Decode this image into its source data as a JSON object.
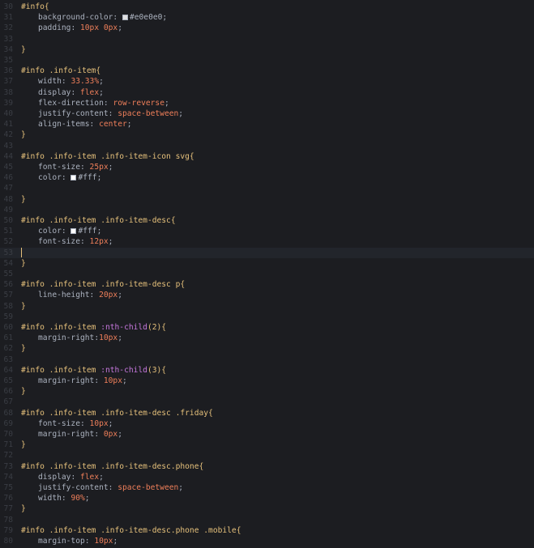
{
  "lines": [
    {
      "n": "30",
      "tokens": [
        {
          "t": "#info{",
          "c": "sel"
        }
      ]
    },
    {
      "n": "31",
      "indent": true,
      "tokens": [
        {
          "t": "background-color",
          "c": "prop"
        },
        {
          "t": ": ",
          "c": "colon"
        },
        {
          "t": "swatch",
          "c": "swatch",
          "color": "#e0e0e0"
        },
        {
          "t": "#e0e0e0",
          "c": "prop"
        },
        {
          "t": ";",
          "c": "semi"
        }
      ]
    },
    {
      "n": "32",
      "indent": true,
      "tokens": [
        {
          "t": "padding",
          "c": "prop"
        },
        {
          "t": ": ",
          "c": "colon"
        },
        {
          "t": "10px 0px",
          "c": "num"
        },
        {
          "t": ";",
          "c": "semi"
        }
      ]
    },
    {
      "n": "33",
      "tokens": []
    },
    {
      "n": "34",
      "tokens": [
        {
          "t": "}",
          "c": "punc"
        }
      ]
    },
    {
      "n": "35",
      "tokens": []
    },
    {
      "n": "36",
      "tokens": [
        {
          "t": "#info .info-item{",
          "c": "sel"
        }
      ]
    },
    {
      "n": "37",
      "indent": true,
      "tokens": [
        {
          "t": "width",
          "c": "prop"
        },
        {
          "t": ": ",
          "c": "colon"
        },
        {
          "t": "33.33%",
          "c": "num"
        },
        {
          "t": ";",
          "c": "semi"
        }
      ]
    },
    {
      "n": "38",
      "indent": true,
      "tokens": [
        {
          "t": "display",
          "c": "prop"
        },
        {
          "t": ": ",
          "c": "colon"
        },
        {
          "t": "flex",
          "c": "kw"
        },
        {
          "t": ";",
          "c": "semi"
        }
      ]
    },
    {
      "n": "39",
      "indent": true,
      "tokens": [
        {
          "t": "flex-direction",
          "c": "prop"
        },
        {
          "t": ": ",
          "c": "colon"
        },
        {
          "t": "row-reverse",
          "c": "kw"
        },
        {
          "t": ";",
          "c": "semi"
        }
      ]
    },
    {
      "n": "40",
      "indent": true,
      "tokens": [
        {
          "t": "justify-content",
          "c": "prop"
        },
        {
          "t": ": ",
          "c": "colon"
        },
        {
          "t": "space-between",
          "c": "kw"
        },
        {
          "t": ";",
          "c": "semi"
        }
      ]
    },
    {
      "n": "41",
      "indent": true,
      "tokens": [
        {
          "t": "align-items",
          "c": "prop"
        },
        {
          "t": ": ",
          "c": "colon"
        },
        {
          "t": "center",
          "c": "kw"
        },
        {
          "t": ";",
          "c": "semi"
        }
      ]
    },
    {
      "n": "42",
      "tokens": [
        {
          "t": "}",
          "c": "punc"
        }
      ]
    },
    {
      "n": "43",
      "tokens": []
    },
    {
      "n": "44",
      "tokens": [
        {
          "t": "#info .info-item .info-item-icon svg{",
          "c": "sel"
        }
      ]
    },
    {
      "n": "45",
      "indent": true,
      "tokens": [
        {
          "t": "font-size",
          "c": "prop"
        },
        {
          "t": ": ",
          "c": "colon"
        },
        {
          "t": "25px",
          "c": "num"
        },
        {
          "t": ";",
          "c": "semi"
        }
      ]
    },
    {
      "n": "46",
      "indent": true,
      "tokens": [
        {
          "t": "color",
          "c": "prop"
        },
        {
          "t": ": ",
          "c": "colon"
        },
        {
          "t": "swatch",
          "c": "swatch",
          "color": "#ffffff"
        },
        {
          "t": "#fff",
          "c": "prop"
        },
        {
          "t": ";",
          "c": "semi"
        }
      ]
    },
    {
      "n": "47",
      "tokens": []
    },
    {
      "n": "48",
      "tokens": [
        {
          "t": "}",
          "c": "punc"
        }
      ]
    },
    {
      "n": "49",
      "tokens": []
    },
    {
      "n": "50",
      "tokens": [
        {
          "t": "#info .info-item .info-item-desc{",
          "c": "sel"
        }
      ]
    },
    {
      "n": "51",
      "indent": true,
      "tokens": [
        {
          "t": "color",
          "c": "prop"
        },
        {
          "t": ": ",
          "c": "colon"
        },
        {
          "t": "swatch",
          "c": "swatch",
          "color": "#ffffff"
        },
        {
          "t": "#fff",
          "c": "prop"
        },
        {
          "t": ";",
          "c": "semi"
        }
      ]
    },
    {
      "n": "52",
      "indent": true,
      "tokens": [
        {
          "t": "font-size",
          "c": "prop"
        },
        {
          "t": ": ",
          "c": "colon"
        },
        {
          "t": "12px",
          "c": "num"
        },
        {
          "t": ";",
          "c": "semi"
        }
      ]
    },
    {
      "n": "53",
      "current": true,
      "tokens": [
        {
          "t": "cursor",
          "c": "cursor"
        }
      ]
    },
    {
      "n": "54",
      "tokens": [
        {
          "t": "}",
          "c": "punc"
        }
      ]
    },
    {
      "n": "55",
      "tokens": []
    },
    {
      "n": "56",
      "tokens": [
        {
          "t": "#info .info-item .info-item-desc p{",
          "c": "sel"
        }
      ]
    },
    {
      "n": "57",
      "indent": true,
      "tokens": [
        {
          "t": "line-height",
          "c": "prop"
        },
        {
          "t": ": ",
          "c": "colon"
        },
        {
          "t": "20px",
          "c": "num"
        },
        {
          "t": ";",
          "c": "semi"
        }
      ]
    },
    {
      "n": "58",
      "tokens": [
        {
          "t": "}",
          "c": "punc"
        }
      ]
    },
    {
      "n": "59",
      "tokens": []
    },
    {
      "n": "60",
      "tokens": [
        {
          "t": "#info .info-item ",
          "c": "sel"
        },
        {
          "t": ":nth-child",
          "c": "pseudo"
        },
        {
          "t": "(2){",
          "c": "sel"
        }
      ]
    },
    {
      "n": "61",
      "indent": true,
      "tokens": [
        {
          "t": "margin-right",
          "c": "prop"
        },
        {
          "t": ":",
          "c": "colon"
        },
        {
          "t": "10px",
          "c": "num"
        },
        {
          "t": ";",
          "c": "semi"
        }
      ]
    },
    {
      "n": "62",
      "tokens": [
        {
          "t": "}",
          "c": "punc"
        }
      ]
    },
    {
      "n": "63",
      "tokens": []
    },
    {
      "n": "64",
      "tokens": [
        {
          "t": "#info .info-item ",
          "c": "sel"
        },
        {
          "t": ":nth-child",
          "c": "pseudo"
        },
        {
          "t": "(3){",
          "c": "sel"
        }
      ]
    },
    {
      "n": "65",
      "indent": true,
      "tokens": [
        {
          "t": "margin-right",
          "c": "prop"
        },
        {
          "t": ": ",
          "c": "colon"
        },
        {
          "t": "10px",
          "c": "num"
        },
        {
          "t": ";",
          "c": "semi"
        }
      ]
    },
    {
      "n": "66",
      "tokens": [
        {
          "t": "}",
          "c": "punc"
        }
      ]
    },
    {
      "n": "67",
      "tokens": []
    },
    {
      "n": "68",
      "tokens": [
        {
          "t": "#info .info-item .info-item-desc .friday{",
          "c": "sel"
        }
      ]
    },
    {
      "n": "69",
      "indent": true,
      "tokens": [
        {
          "t": "font-size",
          "c": "prop"
        },
        {
          "t": ": ",
          "c": "colon"
        },
        {
          "t": "10px",
          "c": "num"
        },
        {
          "t": ";",
          "c": "semi"
        }
      ]
    },
    {
      "n": "70",
      "indent": true,
      "tokens": [
        {
          "t": "margin-right",
          "c": "prop"
        },
        {
          "t": ": ",
          "c": "colon"
        },
        {
          "t": "0px",
          "c": "num"
        },
        {
          "t": ";",
          "c": "semi"
        }
      ]
    },
    {
      "n": "71",
      "tokens": [
        {
          "t": "}",
          "c": "punc"
        }
      ]
    },
    {
      "n": "72",
      "tokens": []
    },
    {
      "n": "73",
      "tokens": [
        {
          "t": "#info .info-item .info-item-desc.phone{",
          "c": "sel"
        }
      ]
    },
    {
      "n": "74",
      "indent": true,
      "tokens": [
        {
          "t": "display",
          "c": "prop"
        },
        {
          "t": ": ",
          "c": "colon"
        },
        {
          "t": "flex",
          "c": "kw"
        },
        {
          "t": ";",
          "c": "semi"
        }
      ]
    },
    {
      "n": "75",
      "indent": true,
      "tokens": [
        {
          "t": "justify-content",
          "c": "prop"
        },
        {
          "t": ": ",
          "c": "colon"
        },
        {
          "t": "space-between",
          "c": "kw"
        },
        {
          "t": ";",
          "c": "semi"
        }
      ]
    },
    {
      "n": "76",
      "indent": true,
      "tokens": [
        {
          "t": "width",
          "c": "prop"
        },
        {
          "t": ": ",
          "c": "colon"
        },
        {
          "t": "90%",
          "c": "num"
        },
        {
          "t": ";",
          "c": "semi"
        }
      ]
    },
    {
      "n": "77",
      "tokens": [
        {
          "t": "}",
          "c": "punc"
        }
      ]
    },
    {
      "n": "78",
      "tokens": []
    },
    {
      "n": "79",
      "tokens": [
        {
          "t": "#info .info-item .info-item-desc.phone .mobile{",
          "c": "sel"
        }
      ]
    },
    {
      "n": "80",
      "indent": true,
      "tokens": [
        {
          "t": "margin-top",
          "c": "prop"
        },
        {
          "t": ": ",
          "c": "colon"
        },
        {
          "t": "10px",
          "c": "num"
        },
        {
          "t": ";",
          "c": "semi"
        }
      ]
    }
  ]
}
